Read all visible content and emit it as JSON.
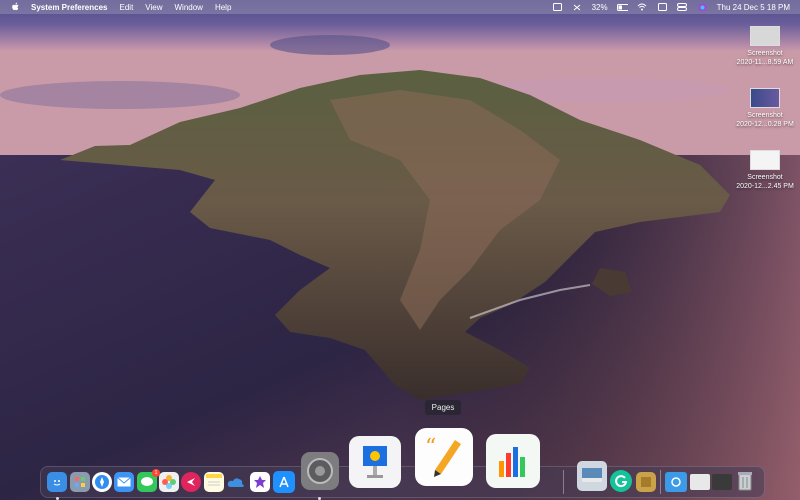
{
  "menubar": {
    "app_name": "System Preferences",
    "menus": [
      "Edit",
      "View",
      "Window",
      "Help"
    ],
    "battery_percent": "32%",
    "datetime": "Thu 24 Dec  5 18 PM"
  },
  "desktop_files": [
    {
      "line1": "Screenshot",
      "line2": "2020-11...8.59 AM"
    },
    {
      "line1": "Screenshot",
      "line2": "2020-12...0.28 PM"
    },
    {
      "line1": "Screenshot",
      "line2": "2020-12...2.45 PM"
    }
  ],
  "tooltip": {
    "label": "Pages"
  },
  "dock": {
    "apps": [
      {
        "name": "finder-icon",
        "color": "#3a8ee6"
      },
      {
        "name": "launchpad-icon",
        "color": "#8a9bb0"
      },
      {
        "name": "safari-icon",
        "color": "#2f8ef0"
      },
      {
        "name": "mail-icon",
        "color": "#3c94f5"
      },
      {
        "name": "messages-icon",
        "color": "#34c759",
        "badge": "1"
      },
      {
        "name": "photos-icon",
        "color": "#f0f0f0"
      },
      {
        "name": "app-circle-icon",
        "color": "#e0245e"
      },
      {
        "name": "notes-icon",
        "color": "#ffd54a"
      },
      {
        "name": "icloud-icon",
        "color": "#3e8fe0"
      },
      {
        "name": "imovie-icon",
        "color": "#7a3fcf"
      },
      {
        "name": "app-store-icon",
        "color": "#1e90ff"
      },
      {
        "name": "system-preferences-icon",
        "color": "#8a8a8a"
      },
      {
        "name": "keynote-icon",
        "color": "#f5f5f5"
      },
      {
        "name": "pages-icon",
        "color": "#fafafa"
      },
      {
        "name": "numbers-icon",
        "color": "#f5f5f5"
      },
      {
        "name": "preview-icon",
        "color": "#cfd8e0"
      },
      {
        "name": "grammarly-icon",
        "color": "#15c39a"
      },
      {
        "name": "utility-app-icon",
        "color": "#c9a24a"
      },
      {
        "name": "screenshot-folder-icon",
        "color": "#3b9be8"
      },
      {
        "name": "documents-stack-icon",
        "color": "#e8e8e8"
      },
      {
        "name": "downloads-stack-icon",
        "color": "#444"
      },
      {
        "name": "trash-icon",
        "color": "#9aa"
      }
    ]
  }
}
